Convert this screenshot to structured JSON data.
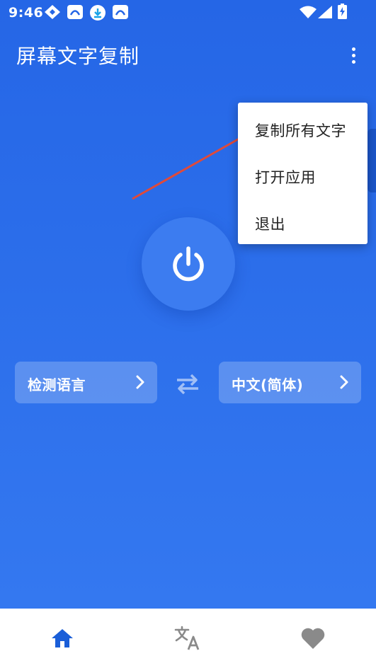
{
  "status_bar": {
    "time": "9:46",
    "icons": [
      "navigation-icon",
      "app-notification-icon",
      "download-icon",
      "app-notification-icon",
      "wifi-icon",
      "signal-icon",
      "battery-charging-icon"
    ]
  },
  "app_bar": {
    "title": "屏幕文字复制",
    "overflow_icon": "more-vert-icon"
  },
  "popup_menu": {
    "items": [
      {
        "label": "复制所有文字"
      },
      {
        "label": "打开应用"
      },
      {
        "label": "退出"
      }
    ]
  },
  "main": {
    "power_icon": "power-icon",
    "source_language": "检测语言",
    "target_language": "中文(简体)",
    "swap_icon": "swap-horiz-icon"
  },
  "bottom_nav": {
    "items": [
      {
        "icon": "home-icon",
        "active": true
      },
      {
        "icon": "translate-icon",
        "active": false
      },
      {
        "icon": "heart-icon",
        "active": false
      }
    ]
  },
  "colors": {
    "primary": "#2566e6",
    "primary_light": "#3478f0",
    "active_nav": "#1a5ed8",
    "inactive_nav": "#8a8a8a",
    "annotation": "#e04a3a"
  }
}
